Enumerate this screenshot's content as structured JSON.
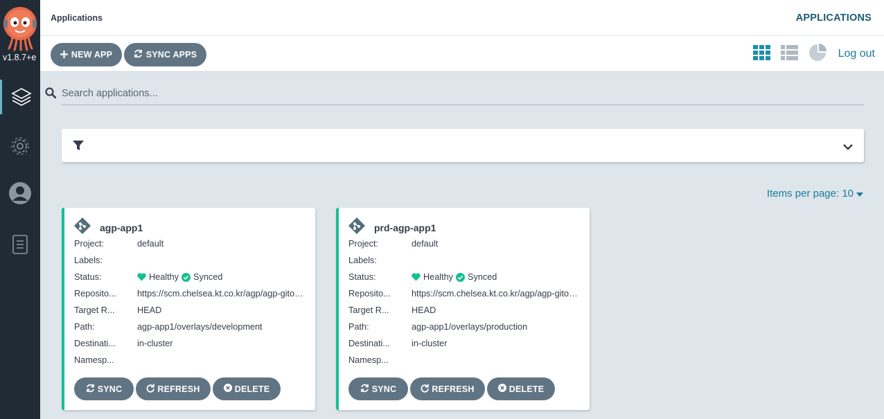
{
  "app": {
    "version": "v1.8.7+e",
    "title": "Applications",
    "title_right": "APPLICATIONS"
  },
  "toolbar": {
    "new_app_label": "NEW APP",
    "sync_apps_label": "SYNC APPS",
    "logout_label": "Log out"
  },
  "search": {
    "placeholder": "Search applications..."
  },
  "pagination": {
    "items_per_page_label": "Items per page: 10"
  },
  "labels": {
    "project": "Project:",
    "labels": "Labels:",
    "status": "Status:",
    "repository": "Reposito...",
    "target": "Target R...",
    "path": "Path:",
    "destination": "Destinati...",
    "namespace": "Namesp...",
    "sync": "SYNC",
    "refresh": "REFRESH",
    "delete": "DELETE"
  },
  "apps": [
    {
      "name": "agp-app1",
      "project": "default",
      "labels": "",
      "health": "Healthy",
      "sync": "Synced",
      "repository": "https://scm.chelsea.kt.co.kr/agp/agp-gitops.git",
      "target_revision": "HEAD",
      "path": "agp-app1/overlays/development",
      "destination": "in-cluster",
      "namespace": ""
    },
    {
      "name": "prd-agp-app1",
      "project": "default",
      "labels": "",
      "health": "Healthy",
      "sync": "Synced",
      "repository": "https://scm.chelsea.kt.co.kr/agp/agp-gitops.git",
      "target_revision": "HEAD",
      "path": "agp-app1/overlays/production",
      "destination": "in-cluster",
      "namespace": ""
    }
  ],
  "colors": {
    "accent": "#1a7a99",
    "healthy": "#18be94",
    "sidebar": "#212b36",
    "button": "#617483"
  },
  "icons": [
    "argo-logo",
    "applications-icon",
    "settings-icon",
    "user-icon",
    "docs-icon",
    "search-icon",
    "filter-icon",
    "chevron-down-icon",
    "tiles-view-icon",
    "list-view-icon",
    "summary-pie-icon",
    "git-icon",
    "heart-icon",
    "check-circle-icon",
    "sync-icon",
    "refresh-icon",
    "delete-icon"
  ]
}
